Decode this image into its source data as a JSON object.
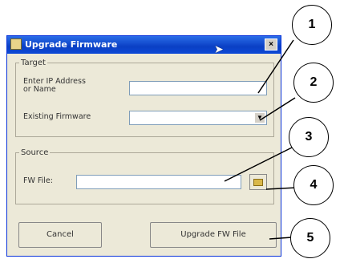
{
  "dialog": {
    "title": "Upgrade Firmware",
    "close_label": "×"
  },
  "target_group": {
    "legend": "Target",
    "ip_label_line1": "Enter IP Address",
    "ip_label_line2": "or Name",
    "ip_value": "",
    "firmware_label": "Existing Firmware",
    "firmware_value": ""
  },
  "source_group": {
    "legend": "Source",
    "fw_file_label": "FW File:",
    "fw_file_value": ""
  },
  "buttons": {
    "cancel": "Cancel",
    "upgrade": "Upgrade FW File"
  },
  "callouts": [
    "1",
    "2",
    "3",
    "4",
    "5"
  ]
}
